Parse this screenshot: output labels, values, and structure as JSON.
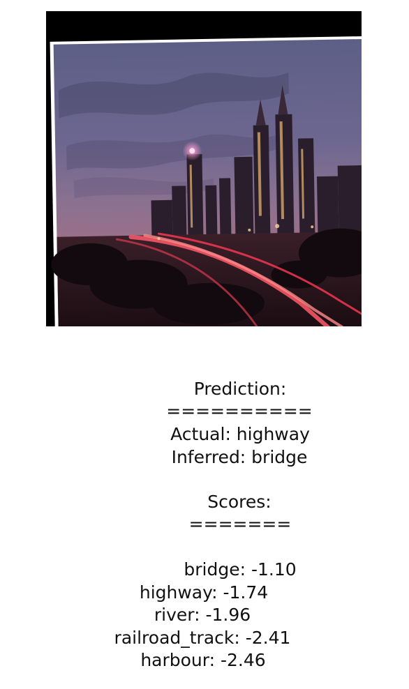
{
  "prediction": {
    "heading": "Prediction:",
    "heading_rule": "==========",
    "actual_line": "Actual: highway",
    "inferred_line": "Inferred: bridge"
  },
  "scores": {
    "heading": "Scores:",
    "heading_rule": "=======",
    "items": [
      {
        "label": "bridge: -1.10"
      },
      {
        "label": "highway: -1.74"
      },
      {
        "label": "river: -1.96"
      },
      {
        "label": "railroad_track: -2.41"
      },
      {
        "label": "harbour: -2.46"
      }
    ]
  },
  "image": {
    "subject": "city-skyline-at-dusk-with-highway-light-trails"
  }
}
